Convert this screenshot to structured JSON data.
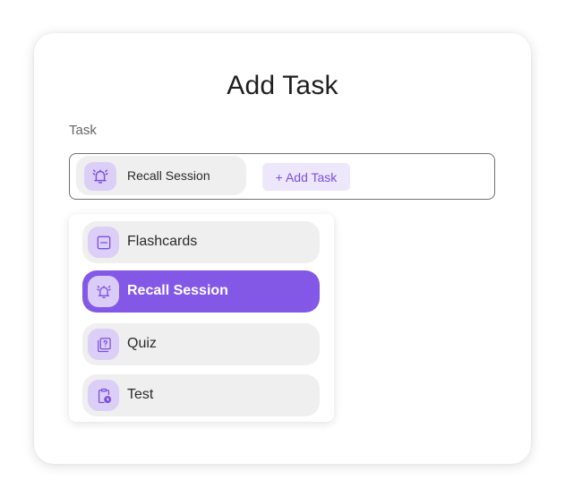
{
  "dialog": {
    "title": "Add Task",
    "field_label": "Task"
  },
  "selected_chip": {
    "label": "Recall Session",
    "icon": "bell-ringing-icon"
  },
  "add_task_button": {
    "label": "+ Add Task"
  },
  "options": [
    {
      "label": "Flashcards",
      "icon": "flashcard-icon",
      "selected": false
    },
    {
      "label": "Recall Session",
      "icon": "bell-ringing-icon",
      "selected": true
    },
    {
      "label": "Quiz",
      "icon": "quiz-icon",
      "selected": false
    },
    {
      "label": "Test",
      "icon": "clipboard-clock-icon",
      "selected": false
    }
  ],
  "colors": {
    "accent": "#8458e6",
    "icon_bg": "#dccff7",
    "icon_stroke": "#7b4fe0",
    "chip_bg": "#efefef",
    "button_bg": "#ede7fb"
  }
}
